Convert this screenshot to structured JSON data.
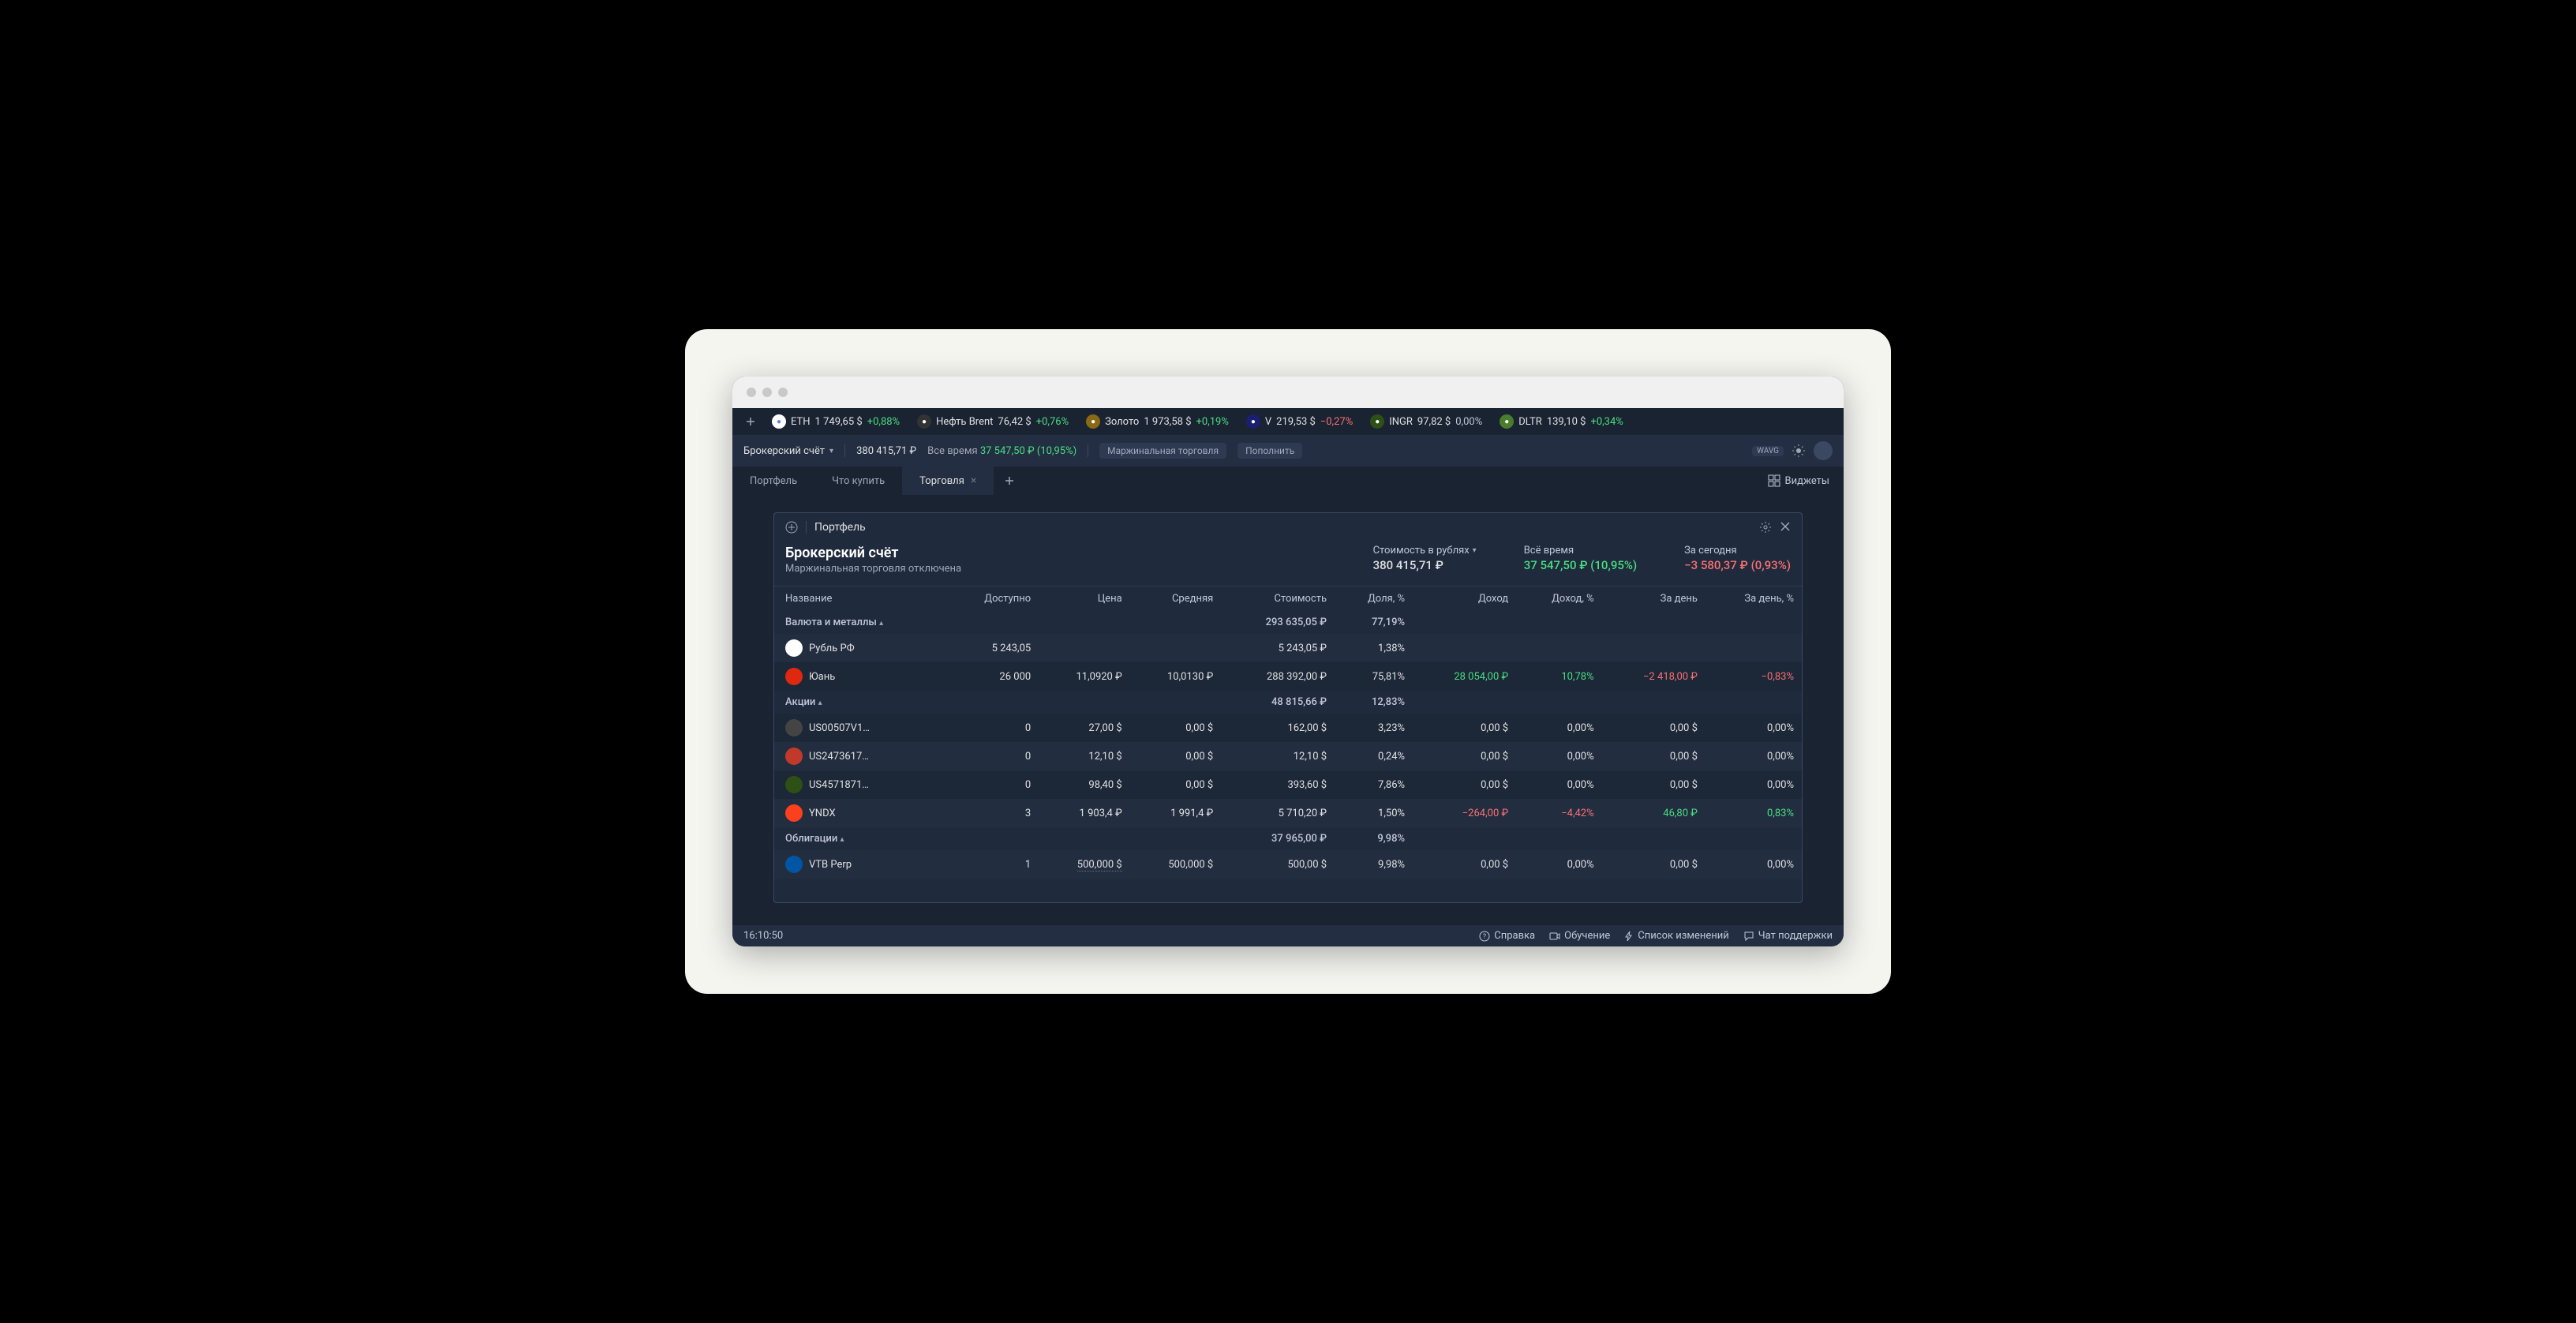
{
  "ticker": [
    {
      "icon_bg": "#fff",
      "icon_color": "#627eea",
      "sym": "ETH",
      "price": "1 749,65 $",
      "change": "+0,88%",
      "cls": "pos"
    },
    {
      "icon_bg": "#333",
      "icon_color": "#fff",
      "sym": "Нефть Brent",
      "price": "76,42 $",
      "change": "+0,76%",
      "cls": "pos"
    },
    {
      "icon_bg": "#8b6914",
      "icon_color": "#fff",
      "sym": "Золото",
      "price": "1 973,58 $",
      "change": "+0,19%",
      "cls": "pos"
    },
    {
      "icon_bg": "#1a1f71",
      "icon_color": "#fff",
      "sym": "V",
      "price": "219,53 $",
      "change": "−0,27%",
      "cls": "neg"
    },
    {
      "icon_bg": "#2d5016",
      "icon_color": "#fff",
      "sym": "INGR",
      "price": "97,82 $",
      "change": "0,00%",
      "cls": "neutral"
    },
    {
      "icon_bg": "#4a7c2e",
      "icon_color": "#fff",
      "sym": "DLTR",
      "price": "139,10 $",
      "change": "+0,34%",
      "cls": "pos"
    }
  ],
  "header": {
    "account_label": "Брокерский счёт",
    "balance": "380 415,71 ₽",
    "alltime_label": "Все время",
    "alltime_value": "37 547,50 ₽ (10,95%)",
    "margin_label": "Маржинальная торговля",
    "topup_label": "Пополнить",
    "wavg": "WAVG"
  },
  "tabs": {
    "portfolio": "Портфель",
    "buy": "Что купить",
    "trade": "Торговля",
    "widgets": "Виджеты"
  },
  "panel": {
    "title": "Портфель",
    "account_name": "Брокерский счёт",
    "account_sub": "Маржинальная торговля отключена",
    "value_label": "Стоимость в рублях",
    "value": "380 415,71 ₽",
    "alltime_label": "Всё время",
    "alltime_value": "37 547,50 ₽ (10,95%)",
    "today_label": "За сегодня",
    "today_value": "−3 580,37 ₽ (0,93%)"
  },
  "cols": {
    "name": "Название",
    "avail": "Доступно",
    "price": "Цена",
    "avg": "Средняя",
    "value": "Стоимость",
    "share": "Доля, %",
    "income": "Доход",
    "income_pct": "Доход, %",
    "day": "За день",
    "day_pct": "За день, %"
  },
  "groups": [
    {
      "name": "Валюта и металлы",
      "value": "293 635,05 ₽",
      "share": "77,19%",
      "items": [
        {
          "icon_bg": "#fff",
          "name": "Рубль РФ",
          "avail": "5 243,05",
          "price": "",
          "avg": "",
          "value": "5 243,05 ₽",
          "share": "1,38%",
          "income": "",
          "income_pct": "",
          "day": "",
          "day_pct": ""
        },
        {
          "icon_bg": "#de2910",
          "name": "Юань",
          "avail": "26 000",
          "price": "11,0920 ₽",
          "avg": "10,0130 ₽",
          "value": "288 392,00 ₽",
          "share": "75,81%",
          "income": "28 054,00 ₽",
          "income_cls": "pos",
          "income_pct": "10,78%",
          "income_pct_cls": "pos",
          "day": "−2 418,00 ₽",
          "day_cls": "neg",
          "day_pct": "−0,83%",
          "day_pct_cls": "neg"
        }
      ]
    },
    {
      "name": "Акции",
      "value": "48 815,66 ₽",
      "share": "12,83%",
      "items": [
        {
          "icon_bg": "#444",
          "name": "US00507V1…",
          "avail": "0",
          "price": "27,00 $",
          "avg": "0,00 $",
          "value": "162,00 $",
          "share": "3,23%",
          "income": "0,00 $",
          "income_pct": "0,00%",
          "day": "0,00 $",
          "day_pct": "0,00%"
        },
        {
          "icon_bg": "#c0392b",
          "name": "US2473617…",
          "avail": "0",
          "price": "12,10 $",
          "avg": "0,00 $",
          "value": "12,10 $",
          "share": "0,24%",
          "income": "0,00 $",
          "income_pct": "0,00%",
          "day": "0,00 $",
          "day_pct": "0,00%"
        },
        {
          "icon_bg": "#2d5016",
          "name": "US4571871…",
          "avail": "0",
          "price": "98,40 $",
          "avg": "0,00 $",
          "value": "393,60 $",
          "share": "7,86%",
          "income": "0,00 $",
          "income_pct": "0,00%",
          "day": "0,00 $",
          "day_pct": "0,00%"
        },
        {
          "icon_bg": "#fc3f1d",
          "name": "YNDX",
          "avail": "3",
          "price": "1 903,4 ₽",
          "avg": "1 991,4 ₽",
          "value": "5 710,20 ₽",
          "share": "1,50%",
          "income": "−264,00 ₽",
          "income_cls": "neg",
          "income_pct": "−4,42%",
          "income_pct_cls": "neg",
          "day": "46,80 ₽",
          "day_cls": "pos",
          "day_pct": "0,83%",
          "day_pct_cls": "pos"
        }
      ]
    },
    {
      "name": "Облигации",
      "value": "37 965,00 ₽",
      "share": "9,98%",
      "items": [
        {
          "icon_bg": "#0055a4",
          "name": "VTB Perp",
          "avail": "1",
          "price": "500,000 $",
          "price_dotted": true,
          "avg": "500,000 $",
          "value": "500,00 $",
          "share": "9,98%",
          "income": "0,00 $",
          "income_pct": "0,00%",
          "day": "0,00 $",
          "day_pct": "0,00%"
        }
      ]
    }
  ],
  "footer": {
    "time": "16:10:50",
    "help": "Справка",
    "tutorial": "Обучение",
    "changelog": "Список изменений",
    "support": "Чат поддержки"
  }
}
